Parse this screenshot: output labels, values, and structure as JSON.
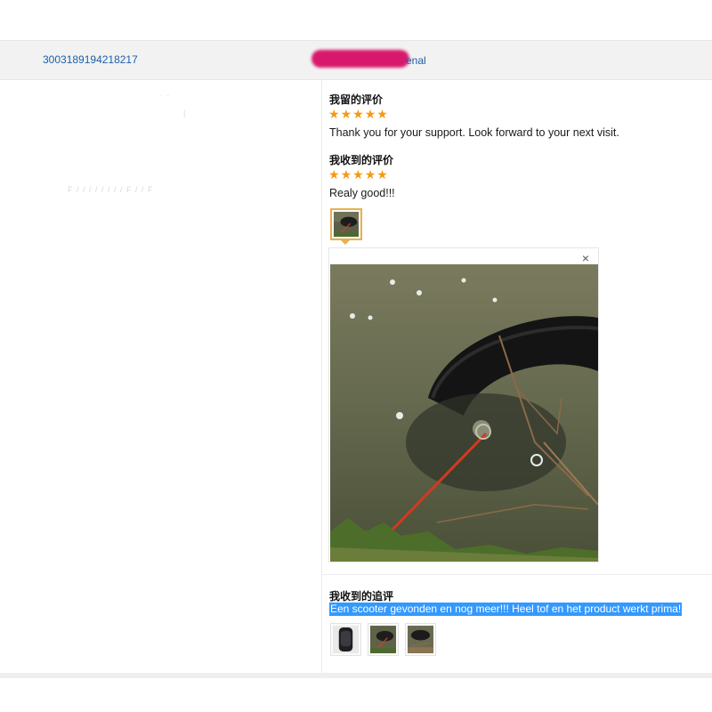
{
  "order": {
    "id": "3003189194218217",
    "store_suffix": "enal"
  },
  "left_panel": {
    "ghost_text": "F / / / / / / / / F / / F"
  },
  "seller_review": {
    "title": "我留的评价",
    "stars": 5,
    "text": "Thank you for your support. Look forward to your next visit."
  },
  "buyer_review": {
    "title": "我收到的评价",
    "stars": 5,
    "text": "Realy good!!!"
  },
  "viewer": {
    "close_symbol": "×"
  },
  "followup": {
    "title": "我收到的追评",
    "text": "Een scooter gevonden en nog meer!!! Heel tof en het product werkt prima!"
  },
  "colors": {
    "star": "#f59a13",
    "link": "#1a5fa8",
    "selection": "#3399ff"
  }
}
